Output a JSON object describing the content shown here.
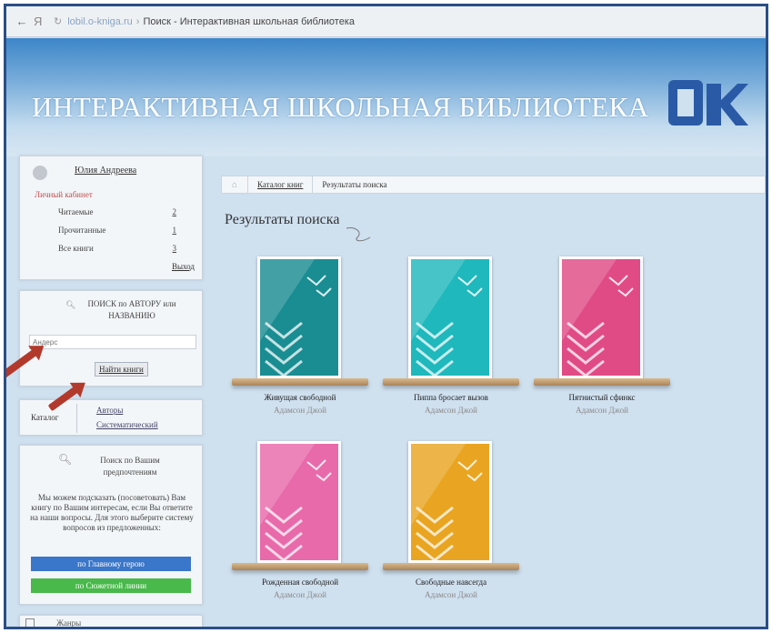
{
  "browser": {
    "ya_label": "Я",
    "url": "lobil.o-kniga.ru",
    "separator": "›",
    "tab_title": "Поиск - Интерактивная школьная библиотека"
  },
  "header": {
    "title": "ИНТЕРАКТИВНАЯ ШКОЛЬНАЯ БИБЛИОТЕКА",
    "logo": "ОК"
  },
  "user_panel": {
    "name": "Юлия Андреева",
    "cabinet": "Личный кабинет",
    "rows": [
      {
        "label": "Читаемые",
        "count": "2"
      },
      {
        "label": "Прочитанные",
        "count": "1"
      },
      {
        "label": "Все книги",
        "count": "3"
      }
    ],
    "exit": "Выход"
  },
  "search_panel": {
    "title": "ПОИСК по АВТОРУ или НАЗВАНИЮ",
    "placeholder": "Андерс",
    "button": "Найти книги"
  },
  "authors_panel": {
    "left": "Каталог",
    "link1": "Авторы",
    "link2": "Систематический"
  },
  "wish_panel": {
    "title": "Поиск по Вашим предпочтениям",
    "description": "Мы можем подсказать (посоветовать) Вам книгу по Вашим интересам, если Вы ответите на наши вопросы. Для этого выберите систему вопросов из предложенных:",
    "button1": "по Главному герою",
    "button2": "по Сюжетной линии"
  },
  "genre_panel": {
    "label": "Жанры"
  },
  "breadcrumb": {
    "item1": "Каталог книг",
    "item2": "Результаты поиска"
  },
  "results": {
    "title": "Результаты поиска",
    "books": [
      {
        "title": "Живущая свободной",
        "author": "Адамсон Джой",
        "color": "#1a8d92"
      },
      {
        "title": "Пиппа бросает вызов",
        "author": "Адамсон Джой",
        "color": "#1fb8bc"
      },
      {
        "title": "Пятнистый сфинкс",
        "author": "Адамсон Джой",
        "color": "#e04b86"
      },
      {
        "title": "Рожденная свободной",
        "author": "Адамсон Джой",
        "color": "#e86aaa"
      },
      {
        "title": "Свободные навсегда",
        "author": "Адамсон Джой",
        "color": "#e9a521"
      }
    ]
  },
  "colors": {
    "arrow": "#b23a2c",
    "frame": "#2a4f86",
    "header": "#3d86c9"
  }
}
